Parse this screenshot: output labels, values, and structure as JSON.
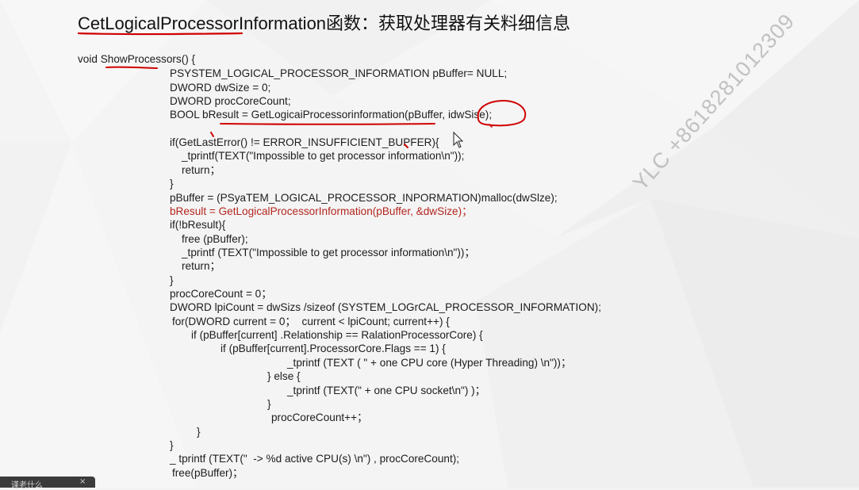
{
  "slide": {
    "title_func": "CetLogicalProcessorInformation",
    "title_rest": "函数：获取处理器有关料细信息",
    "code_lines": [
      {
        "text": "void ShowProcessors() {",
        "color": "normal"
      },
      {
        "text": "PSYSTEM_LOGICAL_PROCESSOR_INFORMATION pBuffer= NULL;",
        "color": "normal"
      },
      {
        "text": "DWORD dwSize = 0;",
        "color": "normal"
      },
      {
        "text": "DWORD procCoreCount;",
        "color": "normal"
      },
      {
        "text": "BOOL bResult = GetLogicaiProcessorinformation(pBuffer, idwSise);",
        "color": "normal"
      },
      {
        "text": "if(GetLastError() != ERROR_INSUFFICIENT_BUPFER){",
        "color": "normal"
      },
      {
        "text": "_tprintf(TEXT(\"Impossible to get processor information\\n\"));",
        "color": "normal"
      },
      {
        "text": "return；",
        "color": "normal"
      },
      {
        "text": "}",
        "color": "normal"
      },
      {
        "text": "pBuffer = (PSyaTEM_LOGICAL_PROCESSOR_INPORMATION)malloc(dwSlze);",
        "color": "normal"
      },
      {
        "text": "bResult = GetLogicalProcessorInformation(pBuffer, &dwSize)；",
        "color": "red"
      },
      {
        "text": "if(!bResult){",
        "color": "normal"
      },
      {
        "text": "free (pBuffer);",
        "color": "normal"
      },
      {
        "text": "_tprintf (TEXT(\"Impossible to get processor information\\n\"))；",
        "color": "normal"
      },
      {
        "text": "return；",
        "color": "normal"
      },
      {
        "text": "}",
        "color": "normal"
      },
      {
        "text": "procCoreCount = 0；",
        "color": "normal"
      },
      {
        "text": "DWORD lpiCount = dwSizs /sizeof (SYSTEM_LOGrCAL_PROCESSOR_INFORMATION);",
        "color": "normal"
      },
      {
        "text": "for(DWORD current = 0；  current < lpiCount; current++) {",
        "color": "normal"
      },
      {
        "text": "if (pBuffer[current] .Relationship == RalationProcessorCore) {",
        "color": "normal"
      },
      {
        "text": "if (pBuffer[current].ProcessorCore.Flags == 1) {",
        "color": "normal"
      },
      {
        "text": "_tprintf (TEXT ( \" + one CPU core (Hyper Threading) \\n\"))；",
        "color": "normal"
      },
      {
        "text": "} else {",
        "color": "normal"
      },
      {
        "text": "_tprintf (TEXT(\" + one CPU socket\\n\") )；",
        "color": "normal"
      },
      {
        "text": "}",
        "color": "normal"
      },
      {
        "text": "procCoreCount++；",
        "color": "normal"
      },
      {
        "text": "}",
        "color": "normal"
      },
      {
        "text": "}",
        "color": "normal"
      },
      {
        "text": "_ tprintf (TEXT(\"  -> %d active CPU(s) \\n\") , procCoreCount);",
        "color": "normal"
      },
      {
        "text": "free(pBuffer)；",
        "color": "normal"
      }
    ],
    "watermark": "YLC +8618281012309",
    "colors": {
      "background": "#f3f3f3",
      "text": "#1c1c1c",
      "highlight": "#b3261e",
      "annotation": "#d00000"
    }
  },
  "player": {
    "bottom_label": "谨老什么",
    "close_glyph": "×"
  }
}
